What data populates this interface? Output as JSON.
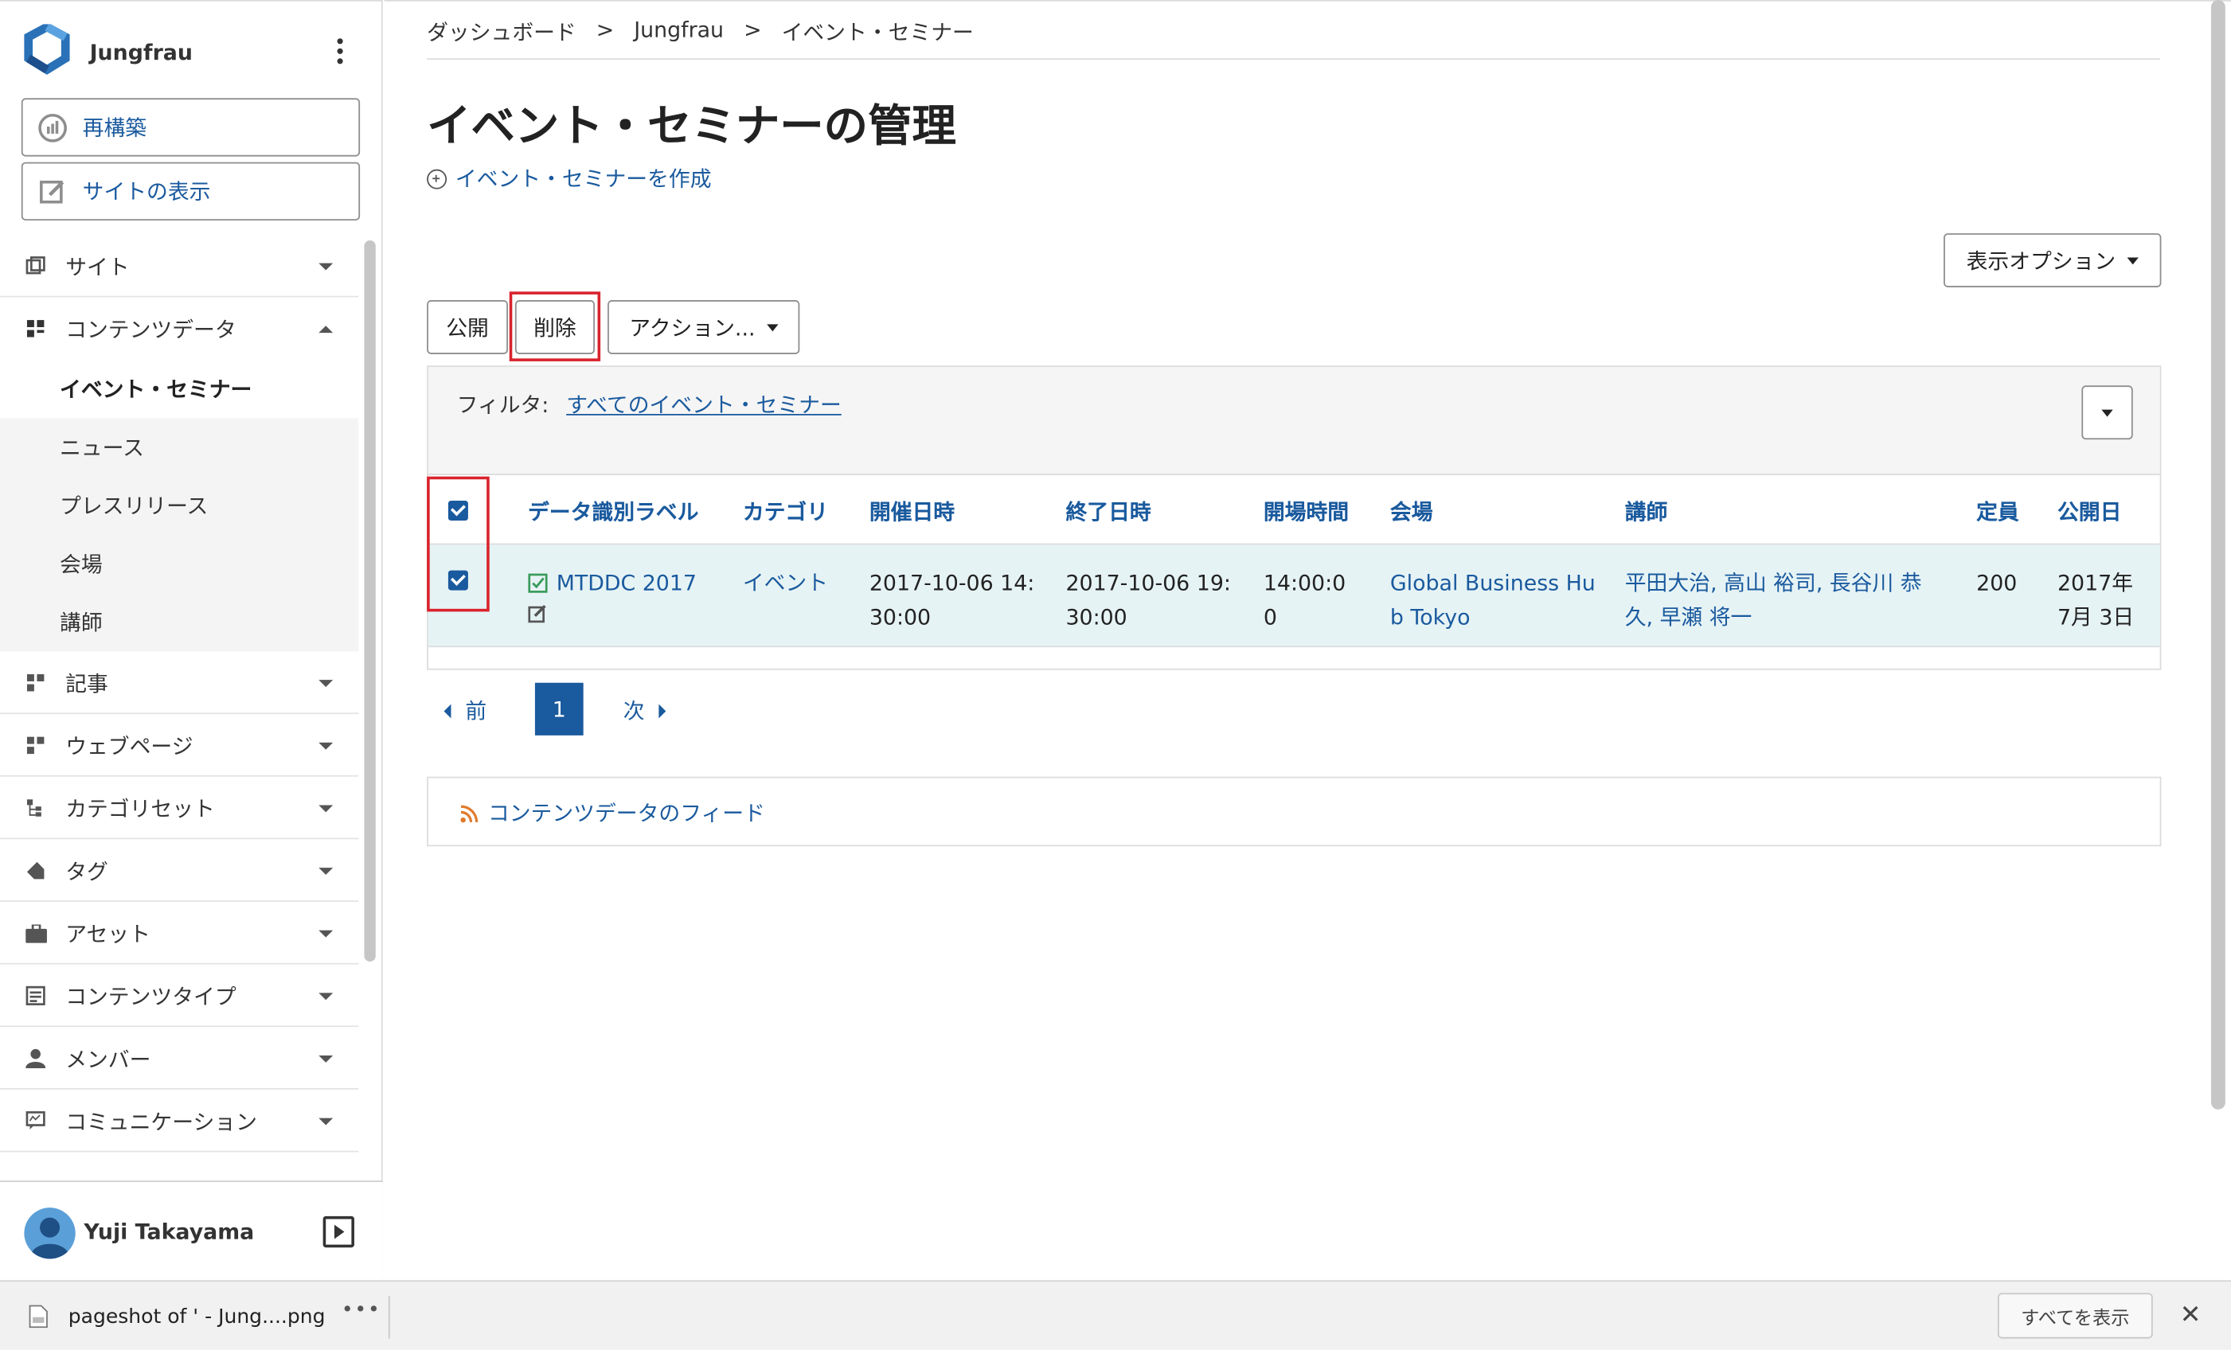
{
  "brand": {
    "name": "Jungfrau"
  },
  "sidebar": {
    "rebuild_label": "再構築",
    "view_site_label": "サイトの表示",
    "nav": [
      {
        "label": "サイト",
        "icon": "sites-icon"
      },
      {
        "label": "コンテンツデータ",
        "icon": "content-data-icon"
      },
      {
        "label": "記事",
        "icon": "entries-icon"
      },
      {
        "label": "ウェブページ",
        "icon": "pages-icon"
      },
      {
        "label": "カテゴリセット",
        "icon": "category-set-icon"
      },
      {
        "label": "タグ",
        "icon": "tag-icon"
      },
      {
        "label": "アセット",
        "icon": "asset-icon"
      },
      {
        "label": "コンテンツタイプ",
        "icon": "content-type-icon"
      },
      {
        "label": "メンバー",
        "icon": "member-icon"
      },
      {
        "label": "コミュニケーション",
        "icon": "communication-icon"
      }
    ],
    "content_data_children": [
      {
        "label": "イベント・セミナー",
        "active": true
      },
      {
        "label": "ニュース"
      },
      {
        "label": "プレスリリース"
      },
      {
        "label": "会場"
      },
      {
        "label": "講師"
      }
    ]
  },
  "user": {
    "name": "Yuji Takayama"
  },
  "breadcrumb": {
    "items": [
      "ダッシュボード",
      "Jungfrau",
      "イベント・セミナー"
    ],
    "separator": ">"
  },
  "page": {
    "title": "イベント・セミナーの管理",
    "create_link": "イベント・セミナーを作成",
    "display_options": "表示オプション"
  },
  "actions": {
    "publish": "公開",
    "delete": "削除",
    "more": "アクション..."
  },
  "filter": {
    "label": "フィルタ:",
    "value": "すべてのイベント・セミナー"
  },
  "table": {
    "headers": [
      "データ識別ラベル",
      "カテゴリ",
      "開催日時",
      "終了日時",
      "開場時間",
      "会場",
      "講師",
      "定員",
      "公開日"
    ],
    "rows": [
      {
        "label": "MTDDC 2017",
        "category": "イベント",
        "start_1": "2017-10-06 14:",
        "start_2": "30:00",
        "end_1": "2017-10-06 19:",
        "end_2": "30:00",
        "open_1": "14:00:0",
        "open_2": "0",
        "venue_1": "Global Business Hu",
        "venue_2": "b Tokyo",
        "speakers_1": "平田大治, 高山 裕司, 長谷川 恭",
        "speakers_2": "久, 早瀬 将一",
        "capacity": "200",
        "published_1": "2017年",
        "published_2": "7月 3日"
      }
    ]
  },
  "pager": {
    "prev": "前",
    "current": "1",
    "next": "次"
  },
  "feed": {
    "label": "コンテンツデータのフィード"
  },
  "download_bar": {
    "filename": "pageshot of ' - Jung....png",
    "more": "•••",
    "show_all": "すべてを表示",
    "close": "✕"
  },
  "colors": {
    "link": "#1a5a9e",
    "highlight_frame": "#d9232d",
    "selected_row": "#e6f3f5"
  }
}
